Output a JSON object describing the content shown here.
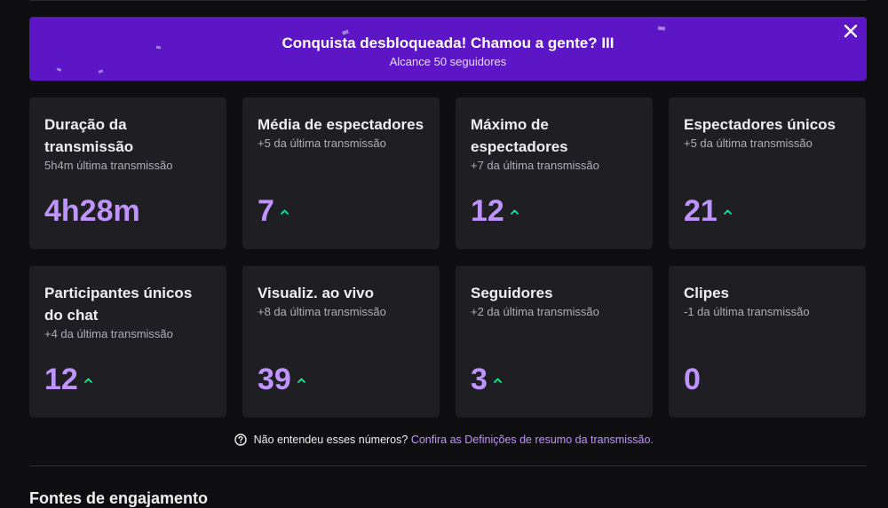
{
  "banner": {
    "title": "Conquista desbloqueada! Chamou a gente? III",
    "subtitle": "Alcance 50 seguidores",
    "close_icon": "close-icon",
    "background": "#5c16c5"
  },
  "stats": [
    {
      "label": "Duração da transmissão",
      "sub": "5h4m última transmissão",
      "value": "4h28m",
      "trend": "none"
    },
    {
      "label": "Média de espectadores",
      "sub": "+5 da última transmissão",
      "value": "7",
      "trend": "up"
    },
    {
      "label": "Máximo de espectadores",
      "sub": "+7 da última transmissão",
      "value": "12",
      "trend": "up"
    },
    {
      "label": "Espectadores únicos",
      "sub": "+5 da última transmissão",
      "value": "21",
      "trend": "up"
    },
    {
      "label": "Participantes únicos do chat",
      "sub": "+4 da última transmissão",
      "value": "12",
      "trend": "up"
    },
    {
      "label": "Visualiz. ao vivo",
      "sub": "+8 da última transmissão",
      "value": "39",
      "trend": "up"
    },
    {
      "label": "Seguidores",
      "sub": "+2 da última transmissão",
      "value": "3",
      "trend": "up"
    },
    {
      "label": "Clipes",
      "sub": "-1 da última transmissão",
      "value": "0",
      "trend": "none"
    }
  ],
  "help": {
    "text": "Não entendeu esses números?",
    "link": "Confira as Definições de resumo da transmissão.",
    "icon": "question-circle-icon"
  },
  "next_section": {
    "heading": "Fontes de engajamento"
  },
  "colors": {
    "accent": "#bf94ff",
    "trend_up": "#00f593",
    "card_bg": "#1f1f23",
    "page_bg": "#0e0e10"
  }
}
